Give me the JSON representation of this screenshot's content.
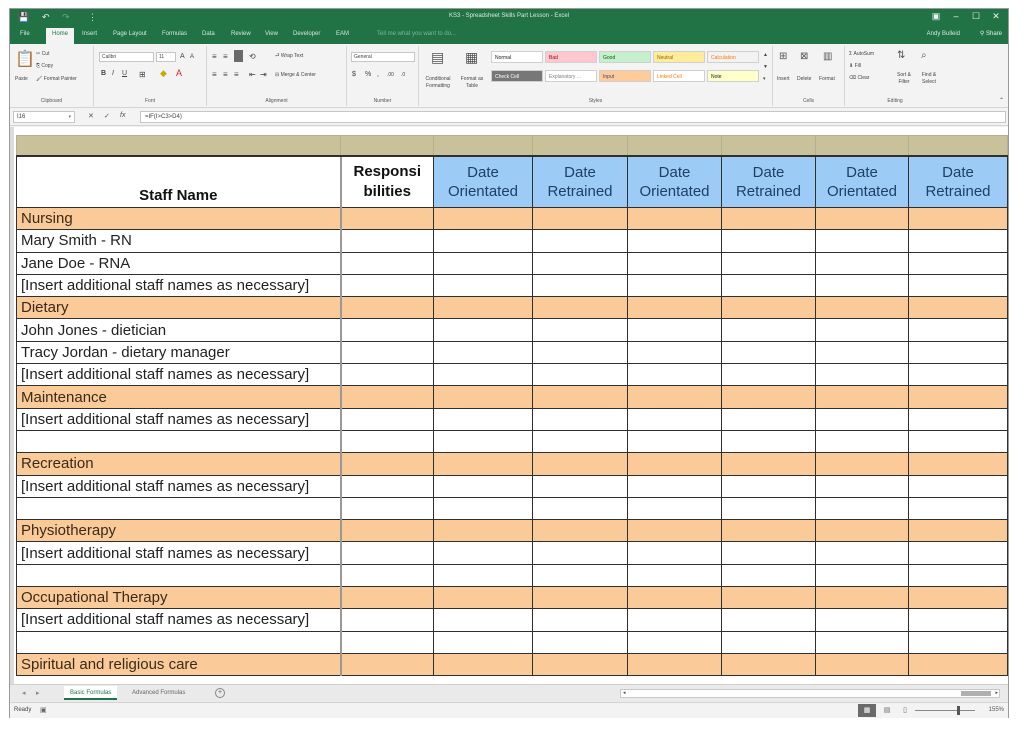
{
  "window": {
    "title": "KS3 - Spreadsheet Skills Part Lesson - Excel",
    "controls": {
      "ribbon_display": "▣",
      "minimize": "–",
      "restore": "☐",
      "close": "✕"
    }
  },
  "quick_access": {
    "save_icon": "💾",
    "undo_icon": "↶",
    "redo_icon": "↷",
    "customize_icon": "⋮"
  },
  "ribbon_tabs": [
    {
      "label": "File",
      "active": false
    },
    {
      "label": "Home",
      "active": true
    },
    {
      "label": "Insert",
      "active": false
    },
    {
      "label": "Page Layout",
      "active": false
    },
    {
      "label": "Formulas",
      "active": false
    },
    {
      "label": "Data",
      "active": false
    },
    {
      "label": "Review",
      "active": false
    },
    {
      "label": "View",
      "active": false
    },
    {
      "label": "Developer",
      "active": false
    },
    {
      "label": "EAM",
      "active": false
    }
  ],
  "tell_me": "Tell me what you want to do...",
  "user_name": "Andy Bulleid",
  "share_label": "Share",
  "ribbon": {
    "clipboard": {
      "paste": "Paste",
      "cut": "Cut",
      "copy": "Copy",
      "format_painter": "Format Painter",
      "label": "Clipboard"
    },
    "font": {
      "name": "Calibri",
      "size": "11",
      "bold": "B",
      "italic": "I",
      "underline": "U",
      "label": "Font"
    },
    "alignment": {
      "wrap_text": "Wrap Text",
      "merge_center": "Merge & Center",
      "label": "Alignment"
    },
    "number": {
      "format": "General",
      "currency": "$",
      "percent": "%",
      "comma": ",",
      "inc_decimal": ".00",
      "dec_decimal": ".0",
      "label": "Number"
    },
    "styles": {
      "conditional_formatting": "Conditional Formatting",
      "format_as_table": "Format as Table",
      "cells": [
        {
          "label": "Normal",
          "bg": "#ffffff",
          "fg": "#222222"
        },
        {
          "label": "Bad",
          "bg": "#ffc7ce",
          "fg": "#9c0006"
        },
        {
          "label": "Good",
          "bg": "#c6efce",
          "fg": "#006100"
        },
        {
          "label": "Neutral",
          "bg": "#ffeb9c",
          "fg": "#9c6500"
        },
        {
          "label": "Calculation",
          "bg": "#f2f2f2",
          "fg": "#fa7d00"
        },
        {
          "label": "Check Cell",
          "bg": "#777777",
          "fg": "#ffffff"
        },
        {
          "label": "Explanatory ...",
          "bg": "#ffffff",
          "fg": "#7f7f7f"
        },
        {
          "label": "Input",
          "bg": "#ffcc99",
          "fg": "#3f3f76"
        },
        {
          "label": "Linked Cell",
          "bg": "#ffffff",
          "fg": "#fa7d00"
        },
        {
          "label": "Note",
          "bg": "#ffffcc",
          "fg": "#222222"
        }
      ],
      "label": "Styles"
    },
    "cells": {
      "insert": "Insert",
      "delete": "Delete",
      "format": "Format",
      "label": "Cells"
    },
    "editing": {
      "autosum": "AutoSum",
      "fill": "Fill",
      "clear": "Clear",
      "sort_filter": "Sort & Filter",
      "find_select": "Find & Select",
      "label": "Editing"
    }
  },
  "formula_bar": {
    "name_box": "I16",
    "cancel": "✕",
    "enter": "✓",
    "fx": "fx",
    "formula": "=IF(I>C3>D4)"
  },
  "table": {
    "headers": {
      "staff_name": "Staff Name",
      "responsibilities_line1": "Responsi",
      "responsibilities_line2": "bilities",
      "date_cols": [
        {
          "line1": "Date",
          "line2": "Orientated"
        },
        {
          "line1": "Date",
          "line2": "Retrained"
        },
        {
          "line1": "Date",
          "line2": "Orientated"
        },
        {
          "line1": "Date",
          "line2": "Retrained"
        },
        {
          "line1": "Date",
          "line2": "Orientated"
        },
        {
          "line1": "Date",
          "line2": "Retrained"
        }
      ]
    },
    "rows": [
      {
        "type": "category",
        "text": "Nursing"
      },
      {
        "type": "staff",
        "text": "Mary Smith - RN"
      },
      {
        "type": "staff",
        "text": "Jane Doe - RNA"
      },
      {
        "type": "staff",
        "text": "[Insert additional staff names as necessary]"
      },
      {
        "type": "category",
        "text": "Dietary"
      },
      {
        "type": "staff",
        "text": "John Jones - dietician"
      },
      {
        "type": "staff",
        "text": "Tracy Jordan - dietary manager"
      },
      {
        "type": "staff",
        "text": "[Insert additional staff names as necessary]"
      },
      {
        "type": "category",
        "text": "Maintenance"
      },
      {
        "type": "staff",
        "text": "[Insert additional staff names as necessary]"
      },
      {
        "type": "staff",
        "text": ""
      },
      {
        "type": "category",
        "text": "Recreation"
      },
      {
        "type": "staff",
        "text": "[Insert additional staff names as necessary]"
      },
      {
        "type": "staff",
        "text": ""
      },
      {
        "type": "category",
        "text": "Physiotherapy"
      },
      {
        "type": "staff",
        "text": "[Insert additional staff names as necessary]"
      },
      {
        "type": "staff",
        "text": ""
      },
      {
        "type": "category",
        "text": "Occupational Therapy"
      },
      {
        "type": "staff",
        "text": "[Insert additional staff names as necessary]"
      },
      {
        "type": "staff",
        "text": ""
      },
      {
        "type": "category",
        "text": "Spiritual and religious care"
      }
    ],
    "colors": {
      "header_blue": "#9ccbf5",
      "category_orange": "#fbca99",
      "top_band": "#c9c19a"
    }
  },
  "sheet_tabs": [
    {
      "label": "Basic Formulas",
      "active": true
    },
    {
      "label": "Advanced Formulas",
      "active": false
    }
  ],
  "status": {
    "ready": "Ready",
    "zoom": "155%",
    "zoom_fraction": 0.72
  }
}
